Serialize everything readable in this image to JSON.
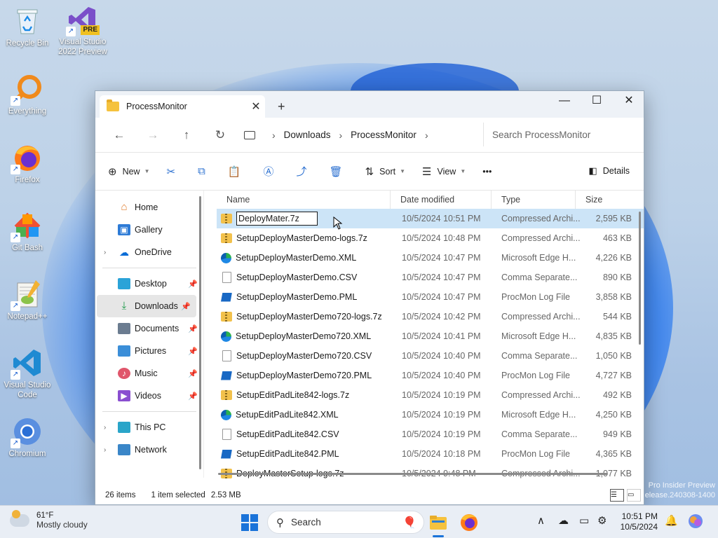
{
  "desktop": {
    "icons": [
      {
        "label": "Recycle Bin",
        "icon": "recycle-bin-icon"
      },
      {
        "label": "Visual Studio 2022 Preview",
        "icon": "visual-studio-preview-icon",
        "badge": "PRE"
      },
      {
        "label": "Everything",
        "icon": "everything-search-icon"
      },
      {
        "label": "Firefox",
        "icon": "firefox-icon"
      },
      {
        "label": "Git Bash",
        "icon": "git-bash-icon"
      },
      {
        "label": "Notepad++",
        "icon": "notepad-plus-plus-icon"
      },
      {
        "label": "Visual Studio Code",
        "icon": "vscode-icon"
      },
      {
        "label": "Chromium",
        "icon": "chromium-icon"
      }
    ],
    "watermark": {
      "line1": "Pro Insider Preview",
      "line2": "elease.240308-1400"
    }
  },
  "window": {
    "tab_title": "ProcessMonitor",
    "tab_close": "✕",
    "new_tab": "+",
    "controls": {
      "minimize": "—",
      "maximize": "☐",
      "close": "✕"
    },
    "breadcrumb": [
      "Downloads",
      "ProcessMonitor"
    ],
    "search_placeholder": "Search ProcessMonitor",
    "toolbar": {
      "new": "New",
      "sort": "Sort",
      "view": "View",
      "more": "•••",
      "details": "Details"
    },
    "nav": {
      "home": "Home",
      "gallery": "Gallery",
      "onedrive": "OneDrive",
      "desktop": "Desktop",
      "downloads": "Downloads",
      "documents": "Documents",
      "pictures": "Pictures",
      "music": "Music",
      "videos": "Videos",
      "thispc": "This PC",
      "network": "Network"
    },
    "columns": {
      "name": "Name",
      "date": "Date modified",
      "type": "Type",
      "size": "Size"
    },
    "rename_value": "DeployMater.7z",
    "files": [
      {
        "name": "DeployMater.7z",
        "date": "10/5/2024 10:51 PM",
        "type": "Compressed Archi...",
        "size": "2,595 KB",
        "kind": "zip",
        "selected": true
      },
      {
        "name": "SetupDeployMasterDemo-logs.7z",
        "date": "10/5/2024 10:48 PM",
        "type": "Compressed Archi...",
        "size": "463 KB",
        "kind": "zip"
      },
      {
        "name": "SetupDeployMasterDemo.XML",
        "date": "10/5/2024 10:47 PM",
        "type": "Microsoft Edge H...",
        "size": "4,226 KB",
        "kind": "edge"
      },
      {
        "name": "SetupDeployMasterDemo.CSV",
        "date": "10/5/2024 10:47 PM",
        "type": "Comma Separate...",
        "size": "890 KB",
        "kind": "csv"
      },
      {
        "name": "SetupDeployMasterDemo.PML",
        "date": "10/5/2024 10:47 PM",
        "type": "ProcMon Log File",
        "size": "3,858 KB",
        "kind": "pml"
      },
      {
        "name": "SetupDeployMasterDemo720-logs.7z",
        "date": "10/5/2024 10:42 PM",
        "type": "Compressed Archi...",
        "size": "544 KB",
        "kind": "zip"
      },
      {
        "name": "SetupDeployMasterDemo720.XML",
        "date": "10/5/2024 10:41 PM",
        "type": "Microsoft Edge H...",
        "size": "4,835 KB",
        "kind": "edge"
      },
      {
        "name": "SetupDeployMasterDemo720.CSV",
        "date": "10/5/2024 10:40 PM",
        "type": "Comma Separate...",
        "size": "1,050 KB",
        "kind": "csv"
      },
      {
        "name": "SetupDeployMasterDemo720.PML",
        "date": "10/5/2024 10:40 PM",
        "type": "ProcMon Log File",
        "size": "4,727 KB",
        "kind": "pml"
      },
      {
        "name": "SetupEditPadLite842-logs.7z",
        "date": "10/5/2024 10:19 PM",
        "type": "Compressed Archi...",
        "size": "492 KB",
        "kind": "zip"
      },
      {
        "name": "SetupEditPadLite842.XML",
        "date": "10/5/2024 10:19 PM",
        "type": "Microsoft Edge H...",
        "size": "4,250 KB",
        "kind": "edge"
      },
      {
        "name": "SetupEditPadLite842.CSV",
        "date": "10/5/2024 10:19 PM",
        "type": "Comma Separate...",
        "size": "949 KB",
        "kind": "csv"
      },
      {
        "name": "SetupEditPadLite842.PML",
        "date": "10/5/2024 10:18 PM",
        "type": "ProcMon Log File",
        "size": "4,365 KB",
        "kind": "pml"
      },
      {
        "name": "DeployMasterSetup-logs.7z",
        "date": "10/5/2024 9:48 PM",
        "type": "Compressed Archi...",
        "size": "1,077 KB",
        "kind": "zip"
      }
    ],
    "status": {
      "count": "26 items",
      "selected": "1 item selected",
      "size": "2.53 MB"
    }
  },
  "taskbar": {
    "weather_temp": "61°F",
    "weather_desc": "Mostly cloudy",
    "search_label": "Search",
    "time": "10:51 PM",
    "date": "10/5/2024"
  }
}
